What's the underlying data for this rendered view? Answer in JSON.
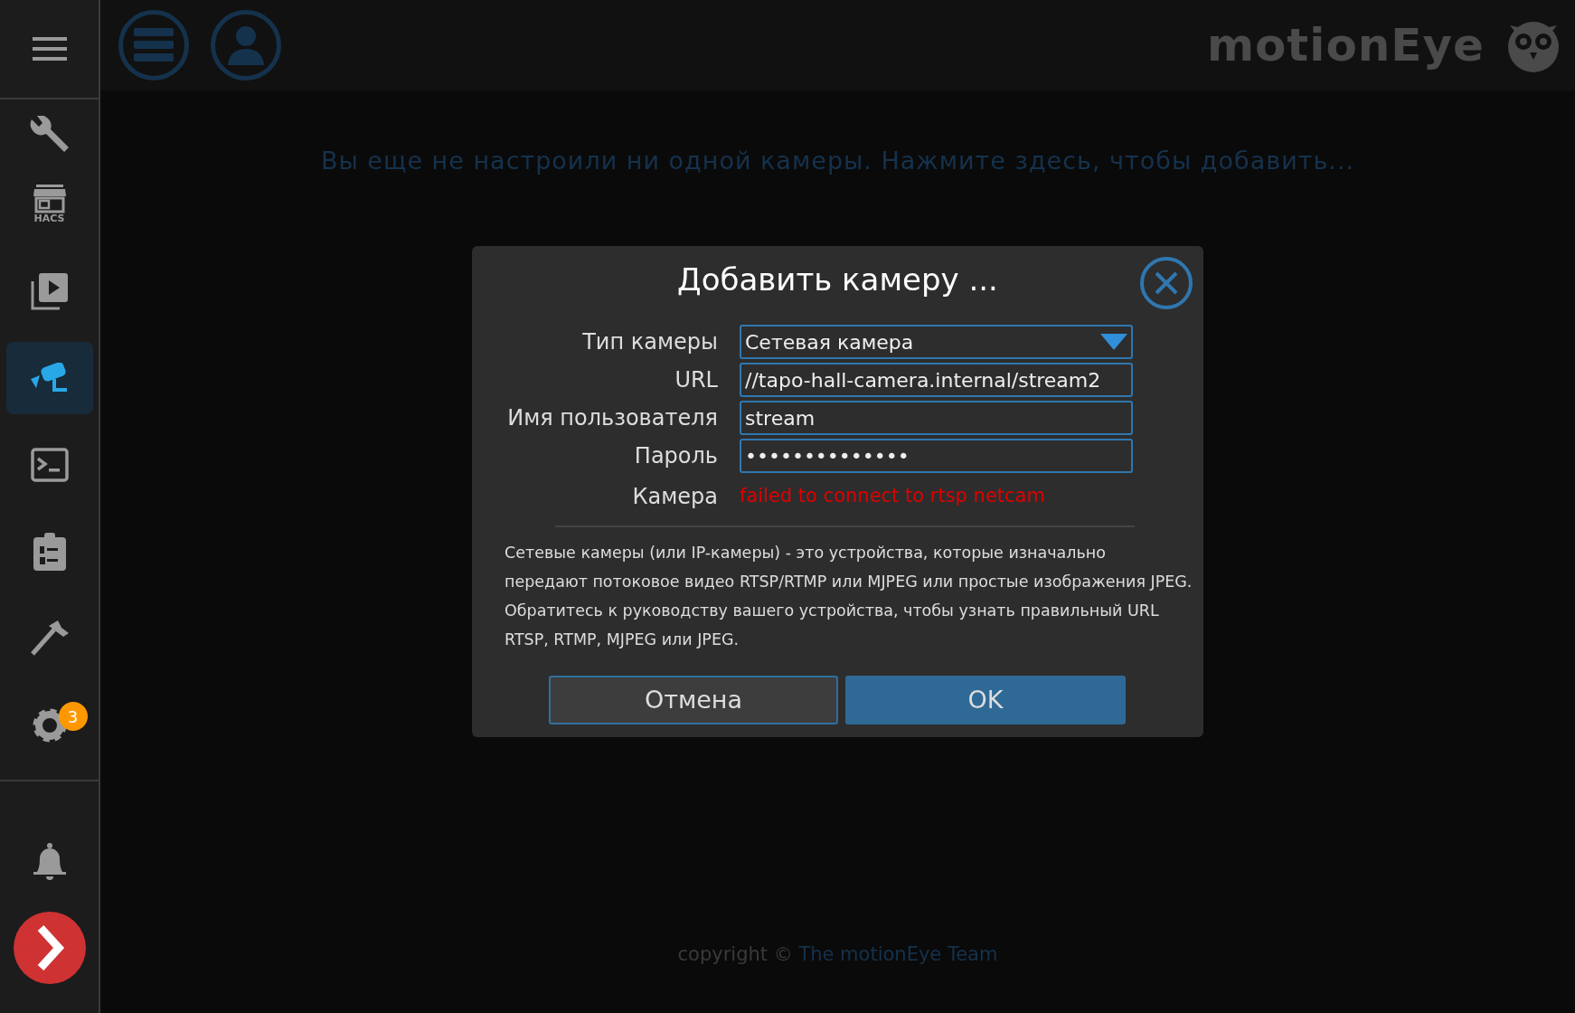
{
  "sidebar": {
    "items": [
      {
        "kind": "menu",
        "selected": false
      },
      {
        "kind": "wrench",
        "selected": false
      },
      {
        "kind": "store",
        "label": "HACS",
        "selected": false
      },
      {
        "kind": "media",
        "selected": false
      },
      {
        "kind": "camera",
        "selected": true
      },
      {
        "kind": "terminal",
        "selected": false
      },
      {
        "kind": "clipboard",
        "selected": false
      },
      {
        "kind": "hammer",
        "selected": false
      },
      {
        "kind": "gear",
        "badge": "3",
        "selected": false
      },
      {
        "kind": "divider"
      },
      {
        "kind": "bell",
        "selected": false
      },
      {
        "kind": "chevron",
        "selected": false
      }
    ]
  },
  "topbar": {
    "buttons": [
      {
        "kind": "menu"
      },
      {
        "kind": "user"
      }
    ],
    "logo": "motionEye"
  },
  "message": "Вы еще не настроили ни одной камеры. Нажмите здесь, чтобы добавить...",
  "dialog": {
    "title": "Добавить камеру ...",
    "fields": [
      {
        "kind": "select",
        "label": "Тип камеры",
        "value": "Сетевая камера"
      },
      {
        "kind": "text",
        "label": "URL",
        "value": "//tapo-hall-camera.internal/stream2"
      },
      {
        "kind": "text",
        "label": "Имя пользователя",
        "value": "stream"
      },
      {
        "kind": "password",
        "label": "Пароль",
        "value": "••••••••••••••"
      },
      {
        "kind": "error",
        "label": "Камера",
        "value": "failed to connect to rtsp netcam"
      }
    ],
    "description": "Сетевые камеры (или IP-камеры) - это устройства, которые изначально передают потоковое видео RTSP/RTMP или MJPEG или простые изображения JPEG. Обратитесь к руководству вашего устройства, чтобы узнать правильный URL RTSP, RTMP, MJPEG или JPEG.",
    "buttons": [
      {
        "label": "Отмена",
        "kind": "secondary"
      },
      {
        "label": "OK",
        "kind": "primary"
      }
    ]
  },
  "footer": {
    "text": "copyright ©",
    "link": "The motionEye Team"
  }
}
